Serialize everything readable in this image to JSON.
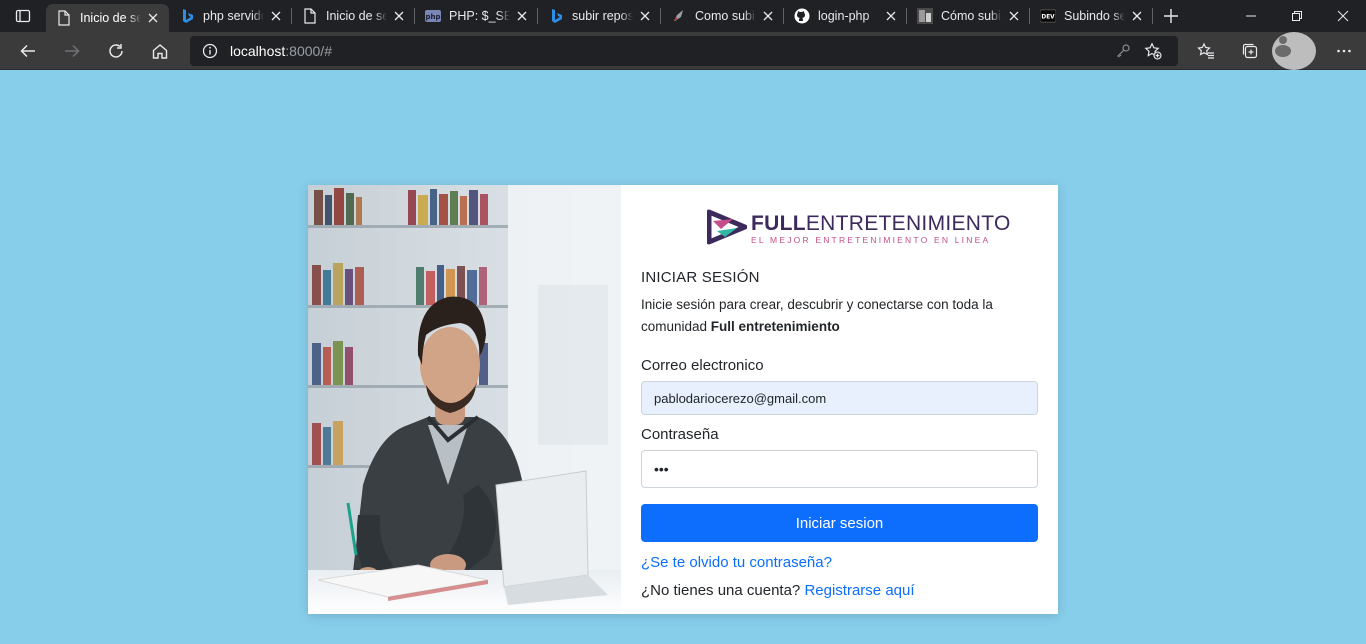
{
  "tabs": [
    {
      "title": "Inicio de sesión",
      "favicon": "page-icon",
      "active": true
    },
    {
      "title": "php servidor",
      "favicon": "bing-icon"
    },
    {
      "title": "Inicio de sesión",
      "favicon": "page-icon"
    },
    {
      "title": "PHP: $_SERVER",
      "favicon": "php-icon"
    },
    {
      "title": "subir repositorio",
      "favicon": "bing-icon"
    },
    {
      "title": "Como subir",
      "favicon": "rocket-icon"
    },
    {
      "title": "login-php",
      "favicon": "github-icon"
    },
    {
      "title": "Cómo subir",
      "favicon": "image-icon"
    },
    {
      "title": "Subindo se",
      "favicon": "dev-icon"
    }
  ],
  "address": {
    "host": "localhost",
    "rest": ":8000/#"
  },
  "colors": {
    "accent": "#0d6efd",
    "background": "#87ceeb",
    "brand": "#3d2a5c",
    "brand_pink": "#c44f8a"
  },
  "logo": {
    "bold": "FULL",
    "light": "ENTRETENIMIENTO",
    "tagline": "EL MEJOR ENTRETENIMIENTO EN LINEA"
  },
  "form": {
    "heading": "INICIAR SESIÓN",
    "desc_prefix": "Inicie sesión para crear, descubrir y conectarse con toda la comunidad ",
    "desc_bold": "Full entretenimiento",
    "email_label": "Correo electronico",
    "email_value": "pablodariocerezo@gmail.com",
    "password_label": "Contraseña",
    "password_value": "•••",
    "submit_label": "Iniciar sesion",
    "forgot_link": "¿Se te olvido tu contraseña?",
    "register_prefix": "¿No tienes una cuenta?",
    "register_link": "Registrarse aquí"
  }
}
